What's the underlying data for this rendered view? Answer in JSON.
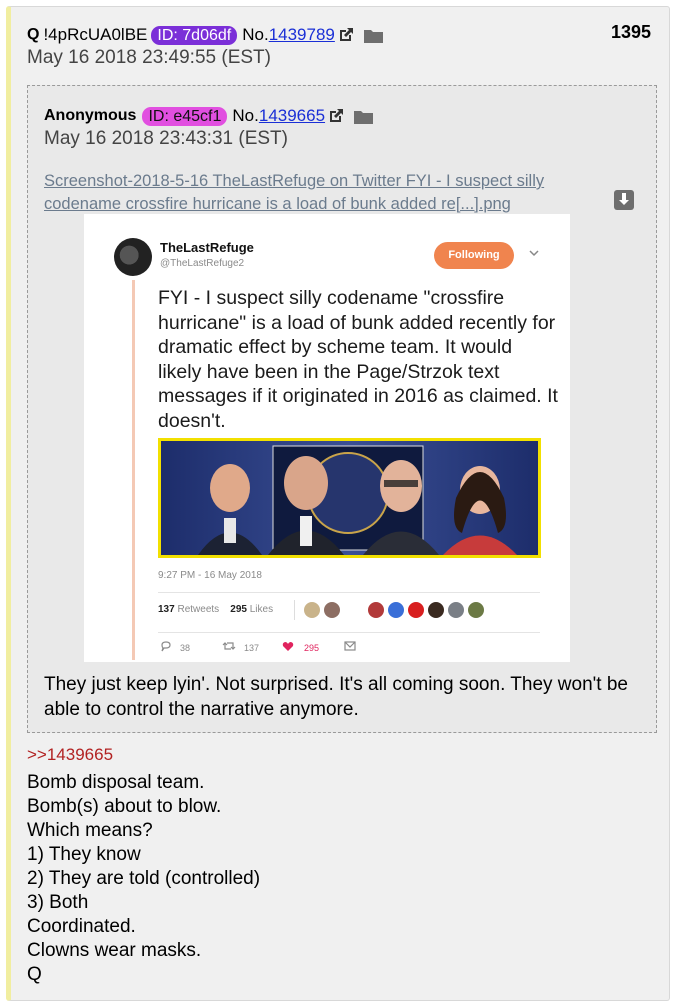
{
  "post": {
    "name": "Q",
    "tripcode": "!4pRcUA0lBE",
    "id_label": "ID: 7d06df",
    "no_prefix": "No.",
    "post_number": "1439789",
    "count": "1395",
    "date": "May 16 2018 23:49:55 (EST)"
  },
  "quoted": {
    "name": "Anonymous",
    "id_label": "ID: e45cf1",
    "no_prefix": "No.",
    "post_number": "1439665",
    "date": "May 16 2018 23:43:31 (EST)",
    "filename": "Screenshot-2018-5-16 TheLastRefuge on Twitter FYI - I suspect silly codename crossfire hurricane is a load of bunk added re[...].png",
    "text": "They just keep lyin'. Not surprised. It's all coming soon. They won't be able to control the narrative anymore."
  },
  "tweet": {
    "author": "TheLastRefuge",
    "handle": "@TheLastRefuge2",
    "follow_label": "Following",
    "text": "FYI - I suspect silly codename \"crossfire hurricane\" is a load of bunk added recently for dramatic effect by scheme team. It would likely have been in the Page/Strzok text messages if it originated in 2016 as claimed.  It doesn't.",
    "time": "9:27 PM - 16 May 2018",
    "retweets": "137",
    "retweets_label": "Retweets",
    "likes": "295",
    "likes_label": "Likes",
    "reply_count": "38",
    "rt_count": "137",
    "like_count": "295"
  },
  "reply_link": ">>1439665",
  "body_lines": [
    "Bomb disposal team.",
    "Bomb(s) about to blow.",
    "Which means?",
    "1) They know",
    "2) They are told (controlled)",
    "3) Both",
    "Coordinated.",
    "Clowns wear masks.",
    "Q"
  ],
  "colors": {
    "id_badge_main": "#7b2fd8",
    "id_badge_quoted": "#e14fe0",
    "link": "#1a2fd6",
    "reply_link": "#b22222",
    "follow_button": "#f0844e"
  },
  "icons": [
    "external-link-icon",
    "folder-icon",
    "download-icon",
    "chevron-down-icon",
    "reply-icon",
    "retweet-icon",
    "heart-icon",
    "mail-icon"
  ]
}
